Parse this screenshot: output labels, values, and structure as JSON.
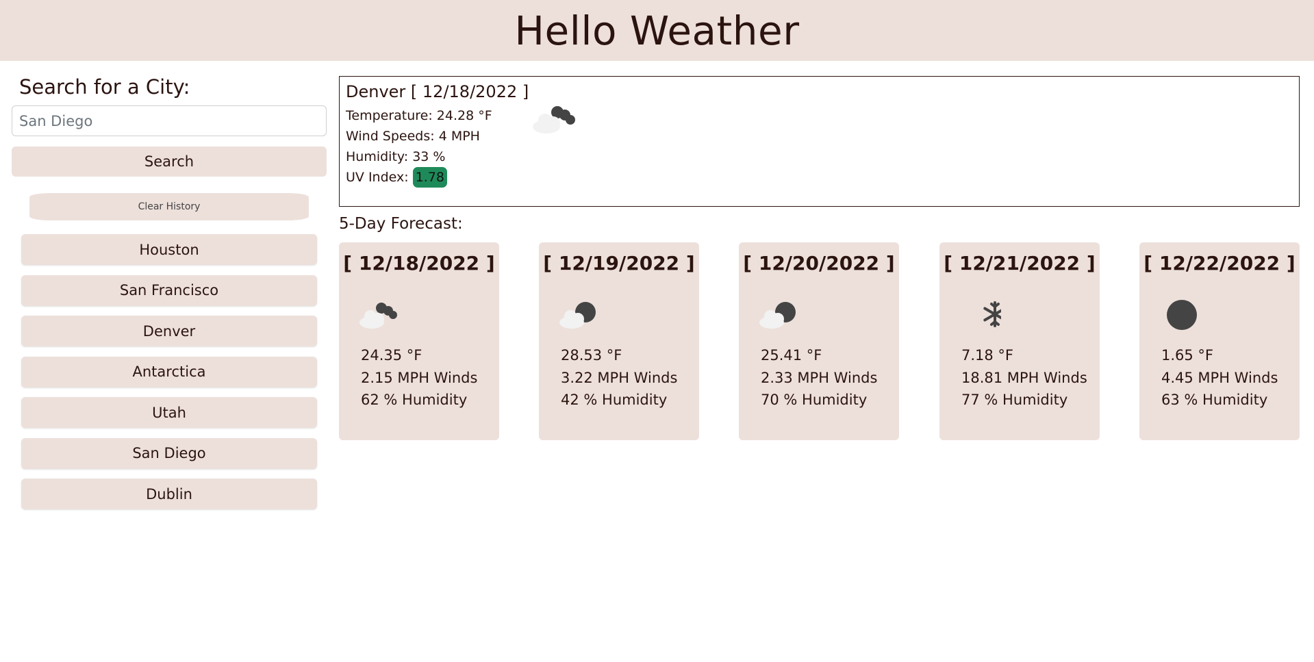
{
  "app": {
    "title": "Hello Weather"
  },
  "search": {
    "heading": "Search for a City:",
    "placeholder": "San Diego",
    "button_label": "Search",
    "clear_label": "Clear History"
  },
  "history": [
    "Houston",
    "San Francisco",
    "Denver",
    "Antarctica",
    "Utah",
    "San Diego",
    "Dublin"
  ],
  "current": {
    "title": "Denver [ 12/18/2022 ]",
    "temperature": "Temperature: 24.28 °F",
    "wind": "Wind Speeds: 4 MPH",
    "humidity": "Humidity: 33 %",
    "uv_label": "UV Index:",
    "uv_value": "1.78",
    "uv_color": "#1e8a5a",
    "icon": "cloudy-night-icon"
  },
  "forecast_heading": "5-Day Forecast:",
  "forecast": [
    {
      "date": "[ 12/18/2022 ]",
      "temp": "24.35 °F",
      "wind": "2.15 MPH Winds",
      "humidity": "62 % Humidity",
      "icon": "cloudy-night-icon"
    },
    {
      "date": "[ 12/19/2022 ]",
      "temp": "28.53 °F",
      "wind": "3.22 MPH Winds",
      "humidity": "42 % Humidity",
      "icon": "partly-cloudy-night-icon"
    },
    {
      "date": "[ 12/20/2022 ]",
      "temp": "25.41 °F",
      "wind": "2.33 MPH Winds",
      "humidity": "70 % Humidity",
      "icon": "partly-cloudy-night-icon"
    },
    {
      "date": "[ 12/21/2022 ]",
      "temp": "7.18 °F",
      "wind": "18.81 MPH Winds",
      "humidity": "77 % Humidity",
      "icon": "snowflake-icon"
    },
    {
      "date": "[ 12/22/2022 ]",
      "temp": "1.65 °F",
      "wind": "4.45 MPH Winds",
      "humidity": "63 % Humidity",
      "icon": "clear-night-icon"
    }
  ],
  "colors": {
    "accent_bg": "#ede0db",
    "text": "#2b1410",
    "icon_dark": "#444444",
    "cloud": "#f2f2f2"
  }
}
